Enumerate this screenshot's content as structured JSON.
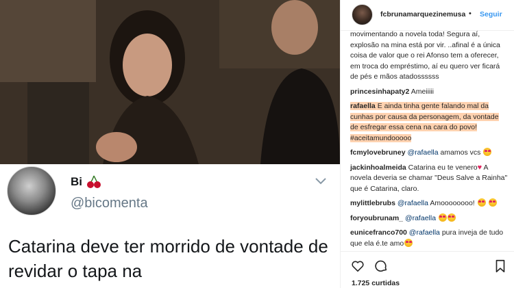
{
  "post": {
    "image_caption": "",
    "tweet": {
      "name": "Bi",
      "handle": "@bicomenta",
      "text": "Catarina deve ter morrido de vontade de revidar o tapa na"
    }
  },
  "header": {
    "username": "fcbrunamarquezinemusa",
    "separator": "•",
    "follow_label": "Seguir"
  },
  "comments": [
    {
      "user": "",
      "text": "movimentando a novela toda! Segura aí, explosão na mina está por vir. ..afinal é a única coisa de valor que o rei Afonso tem a oferecer, em troca do empréstimo, aí eu quero ver ficará de pés e mãos atadossssss"
    },
    {
      "user": "princesinhapaty2",
      "text": "Ameiiiii"
    },
    {
      "user": "rafaella",
      "text": "E ainda tinha gente falando mal da cunhas por causa da personagem, da vontade de esfregar essa cena na cara do povo! #aceitamundooooo"
    },
    {
      "user": "fcmylovebruney",
      "mention": "@rafaella",
      "text": "amamos vcs"
    },
    {
      "user": "jackinhoalmeida",
      "text": "Catarina eu te venero",
      "text2": "A novela deveria se chamar \"Deus Salve a Rainha\" que é Catarina, claro."
    },
    {
      "user": "mylittlebrubs",
      "mention": "@rafaella",
      "text": "Amoooooooo!"
    },
    {
      "user": "foryoubrunam_",
      "mention": "@rafaella",
      "text": ""
    },
    {
      "user": "eunicefranco700",
      "mention": "@rafaella",
      "text": "pura inveja de tudo que ela é.te amo"
    }
  ],
  "actions": {
    "likes": "1.725 curtidas"
  },
  "icons": {
    "like": "heart-outline-icon",
    "comment": "comment-bubble-icon",
    "save": "bookmark-icon",
    "more": "chevron-down-icon",
    "cherry": "cherry-emoji-icon"
  },
  "colors": {
    "follow": "#3897f0",
    "mention": "#003569",
    "highlight": "#ffd2b0"
  }
}
